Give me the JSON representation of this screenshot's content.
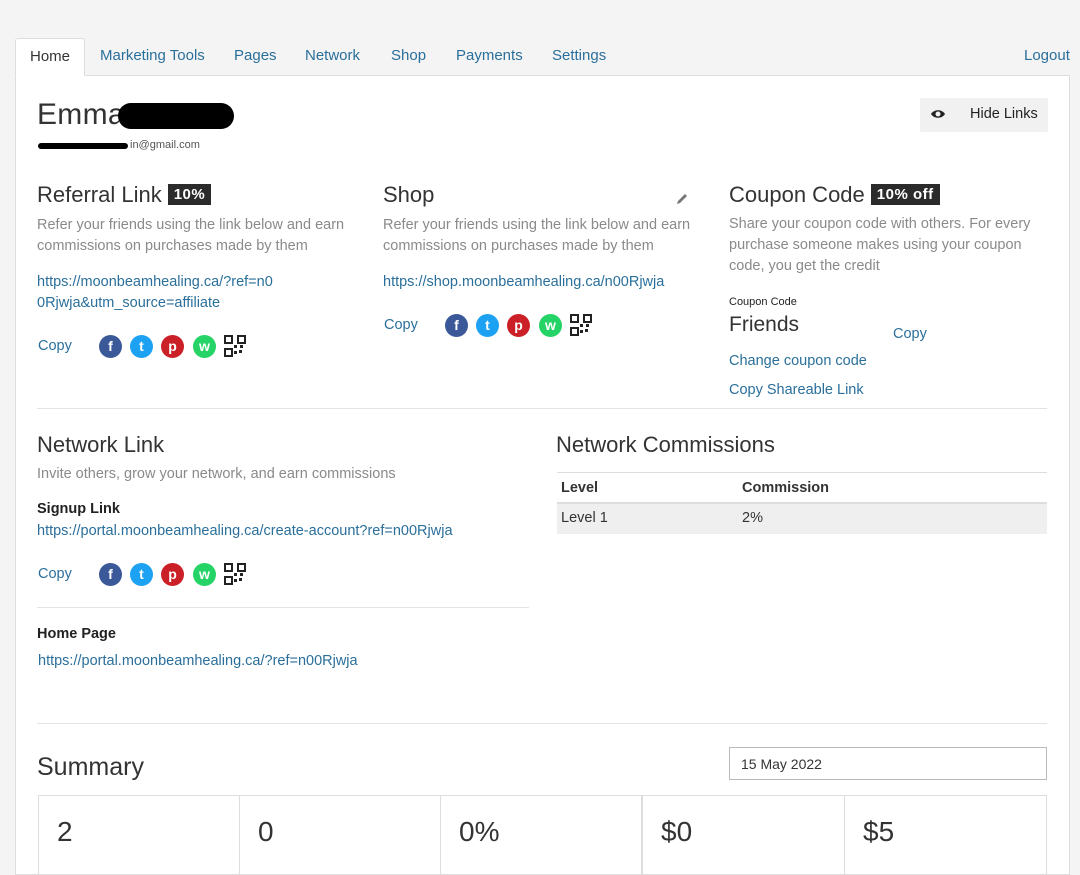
{
  "nav": {
    "tabs": [
      "Home",
      "Marketing Tools",
      "Pages",
      "Network",
      "Shop",
      "Payments",
      "Settings"
    ],
    "logout": "Logout"
  },
  "profile": {
    "first_name": "Emma",
    "email_partial": "in@gmail.com"
  },
  "hide_links": "Hide Links",
  "referral": {
    "title": "Referral Link",
    "badge": "10%",
    "desc": "Refer your friends using the link below and earn commissions on purchases made by them",
    "link": "https://moonbeamhealing.ca/?ref=n00Rjwja&utm_source=affiliate",
    "copy": "Copy"
  },
  "shop": {
    "title": "Shop",
    "desc": "Refer your friends using the link below and earn commissions on purchases made by them",
    "link": "https://shop.moonbeamhealing.ca/n00Rjwja",
    "copy": "Copy"
  },
  "coupon": {
    "title": "Coupon Code",
    "badge": "10% off",
    "desc": "Share your coupon code with others. For every purchase someone makes using your coupon code, you get the credit",
    "code_label": "Coupon Code",
    "code": "Friends",
    "copy": "Copy",
    "change": "Change coupon code",
    "copy_share": "Copy Shareable Link"
  },
  "network_link": {
    "title": "Network Link",
    "desc": "Invite others, grow your network, and earn commissions",
    "signup_label": "Signup Link",
    "signup_url": "https://portal.moonbeamhealing.ca/create-account?ref=n00Rjwja",
    "copy": "Copy",
    "home_label": "Home Page",
    "home_url": "https://portal.moonbeamhealing.ca/?ref=n00Rjwja"
  },
  "network_commissions": {
    "title": "Network Commissions",
    "headers": [
      "Level",
      "Commission"
    ],
    "rows": [
      [
        "Level 1",
        "2%"
      ]
    ]
  },
  "summary": {
    "title": "Summary",
    "date": "15 May 2022",
    "stats": [
      {
        "value": "2"
      },
      {
        "value": "0"
      },
      {
        "value": "0%"
      },
      {
        "value": "$0"
      },
      {
        "value": "$5"
      }
    ]
  },
  "icons": [
    "facebook-icon",
    "twitter-icon",
    "pinterest-icon",
    "whatsapp-icon",
    "qr-code-icon",
    "eye-icon",
    "pencil-icon"
  ]
}
